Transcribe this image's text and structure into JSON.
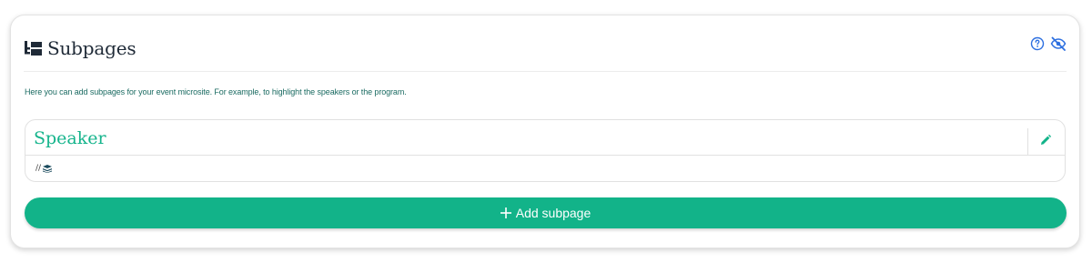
{
  "panel": {
    "title": "Subpages",
    "title_icon": "sitemap-icon",
    "actions": [
      {
        "icon": "help-circle-icon"
      },
      {
        "icon": "eye-slash-icon"
      }
    ],
    "description": "Here you can add subpages for your event microsite. For example, to highlight the speakers or the program."
  },
  "subpages": [
    {
      "title": "Speaker",
      "slug_prefix": "//",
      "edit_icon": "pencil-icon",
      "meta_icon": "layers-icon"
    }
  ],
  "add_button": {
    "label": "Add subpage",
    "icon": "plus-icon"
  },
  "colors": {
    "accent": "#12b389",
    "accent_text": "#15b48c",
    "help_icon": "#2d6fe0",
    "description_text": "#1b6b62",
    "title_text": "#1f2a37"
  }
}
